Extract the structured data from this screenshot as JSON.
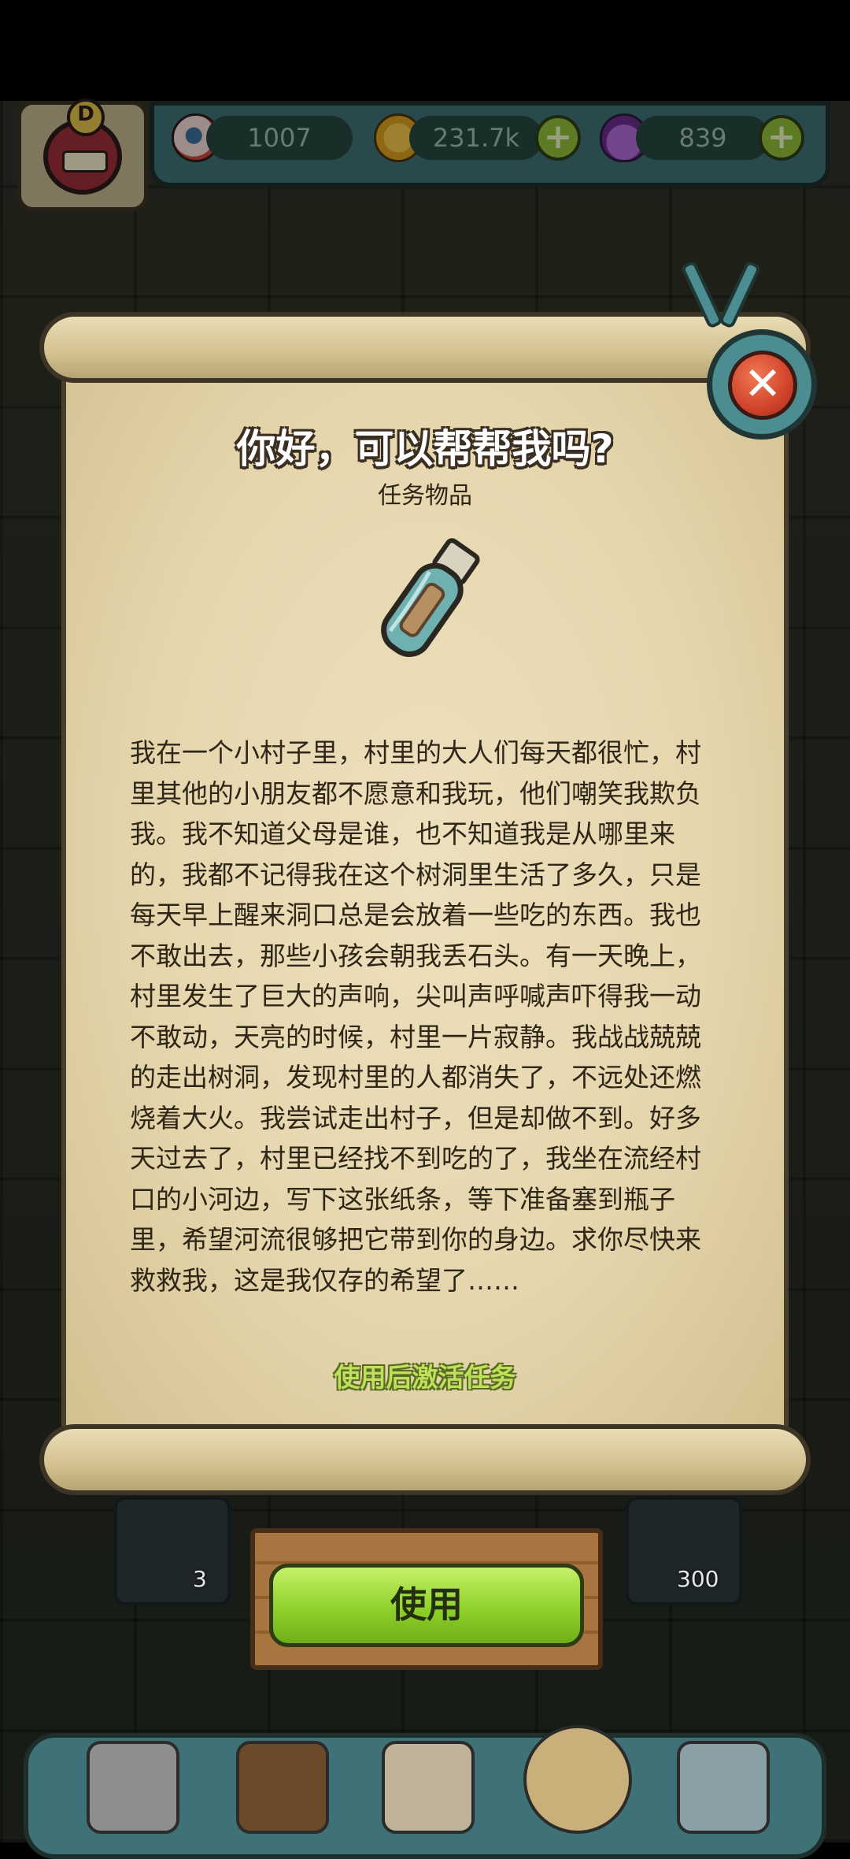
{
  "hud": {
    "avatar_badge": "D",
    "eyeballs": "1007",
    "coins": "231.7k",
    "potions": "839"
  },
  "dialog": {
    "title": "你好，可以帮帮我吗?",
    "subtitle": "任务物品",
    "item_icon": "message-in-bottle-icon",
    "story": "我在一个小村子里，村里的大人们每天都很忙，村里其他的小朋友都不愿意和我玩，他们嘲笑我欺负我。我不知道父母是谁，也不知道我是从哪里来的，我都不记得我在这个树洞里生活了多久，只是每天早上醒来洞口总是会放着一些吃的东西。我也不敢出去，那些小孩会朝我丢石头。有一天晚上，村里发生了巨大的声响，尖叫声呼喊声吓得我一动不敢动，天亮的时候，村里一片寂静。我战战兢兢的走出树洞，发现村里的人都消失了，不远处还燃烧着大火。我尝试走出村子，但是却做不到。好多天过去了，村里已经找不到吃的了，我坐在流经村口的小河边，写下这张纸条，等下准备塞到瓶子里，希望河流很够把它带到你的身边。求你尽快来救救我，这是我仅存的希望了……",
    "hint": "使用后激活任务",
    "use_label": "使用"
  },
  "inventory": {
    "slot1_count": "3",
    "slot5_count": "300"
  },
  "colors": {
    "accent_green": "#8fd12a",
    "close_red": "#d1432b",
    "hud_teal": "#3f7276",
    "paper": "#e5d6ad"
  }
}
